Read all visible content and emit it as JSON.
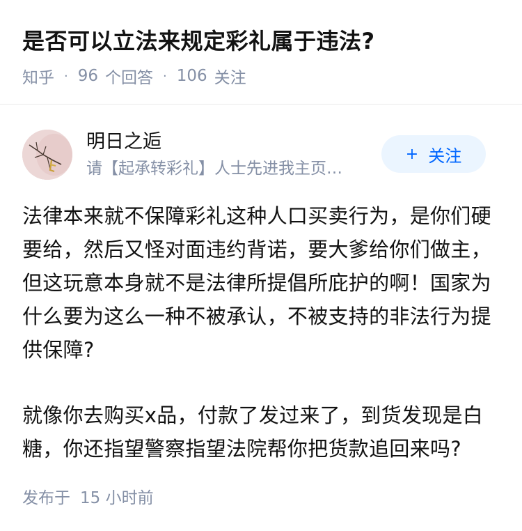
{
  "question": {
    "title": "是否可以立法来规定彩礼属于违法?",
    "source": "知乎",
    "answer_count": "96",
    "answer_label": "个回答",
    "follower_count": "106",
    "follower_label": "关注",
    "separator": "·"
  },
  "author": {
    "name": "明日之逅",
    "bio": "请【起承转彩礼】人士先进我主页…",
    "follow_plus": "+",
    "follow_label": "关注"
  },
  "answer": {
    "paragraphs": [
      "法律本来就不保障彩礼这种人口买卖行为，是你们硬要给，然后又怪对面违约背诺，要大爹给你们做主，但这玩意本身就不是法律所提倡所庇护的啊！国家为什么要为这么一种不被承认，不被支持的非法行为提供保障?",
      "就像你去购买x品，付款了发过来了，到货发现是白糖，你还指望警察指望法院帮你把货款追回来吗?"
    ],
    "published_label": "发布于",
    "published_time": "15 小时前"
  },
  "colors": {
    "text_primary": "#121212",
    "text_secondary": "#8590a6",
    "accent": "#0066ff",
    "follow_bg": "#ebf5ff"
  }
}
